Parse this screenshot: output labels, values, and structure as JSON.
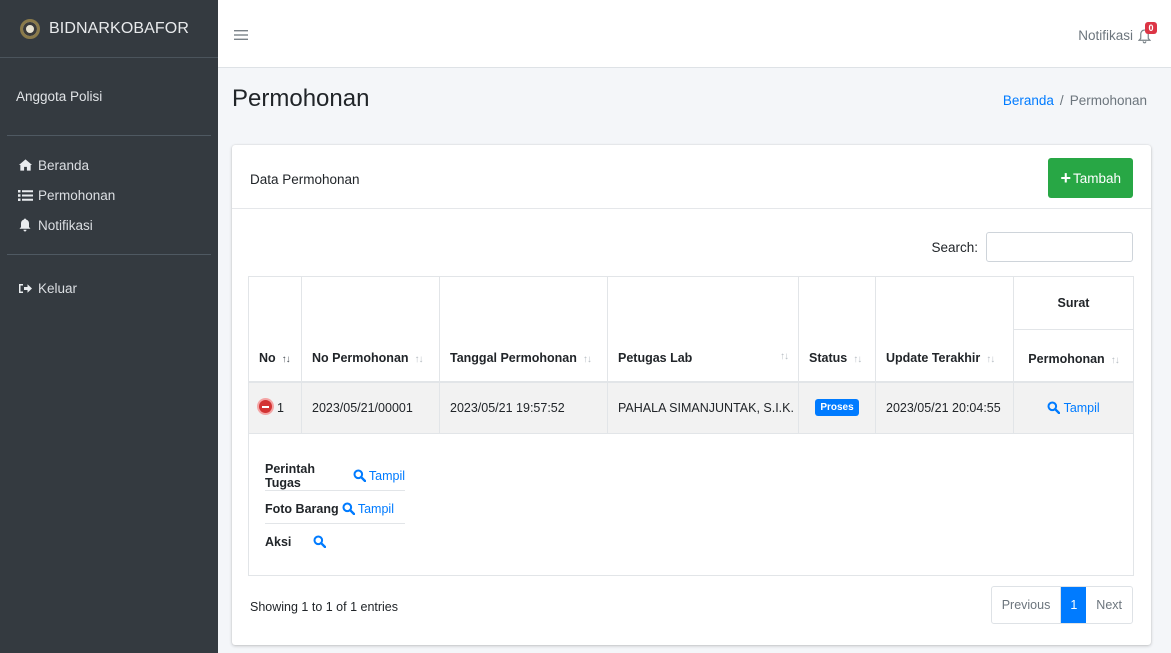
{
  "brand": {
    "name": "BIDNARKOBAFOR"
  },
  "user": {
    "role": "Anggota Polisi"
  },
  "sidebar": {
    "items": [
      {
        "label": "Beranda",
        "icon": "home-icon"
      },
      {
        "label": "Permohonan",
        "icon": "list-icon"
      },
      {
        "label": "Notifikasi",
        "icon": "bell-icon"
      }
    ],
    "logout": {
      "label": "Keluar",
      "icon": "sign-out-icon"
    }
  },
  "navbar": {
    "notif_label": "Notifikasi",
    "notif_count": "0"
  },
  "page": {
    "title": "Permohonan"
  },
  "breadcrumb": {
    "home": "Beranda",
    "sep": "/",
    "current": "Permohonan"
  },
  "card": {
    "title": "Data Permohonan",
    "add_button": "Tambah"
  },
  "search": {
    "label": "Search:",
    "value": ""
  },
  "table": {
    "headers": {
      "no": "No",
      "no_permohonan": "No Permohonan",
      "tanggal": "Tanggal Permohonan",
      "petugas": "Petugas Lab",
      "status": "Status",
      "update": "Update Terakhir",
      "surat_group": "Surat",
      "surat_permohonan": "Permohonan"
    },
    "rows": [
      {
        "no": "1",
        "no_permohonan": "2023/05/21/00001",
        "tanggal": "2023/05/21 19:57:52",
        "petugas": "PAHALA SIMANJUNTAK, S.I.K.",
        "status": "Proses",
        "update": "2023/05/21 20:04:55",
        "surat_link": "Tampil"
      }
    ],
    "child": {
      "perintah_label": "Perintah Tugas",
      "perintah_link": "Tampil",
      "foto_label": "Foto Barang",
      "foto_link": "Tampil",
      "aksi_label": "Aksi"
    }
  },
  "footer": {
    "info": "Showing 1 to 1 of 1 entries",
    "prev": "Previous",
    "page": "1",
    "next": "Next"
  },
  "colors": {
    "sidebar": "#343a40",
    "primary": "#007bff",
    "success": "#28a745",
    "danger": "#dc3545"
  }
}
